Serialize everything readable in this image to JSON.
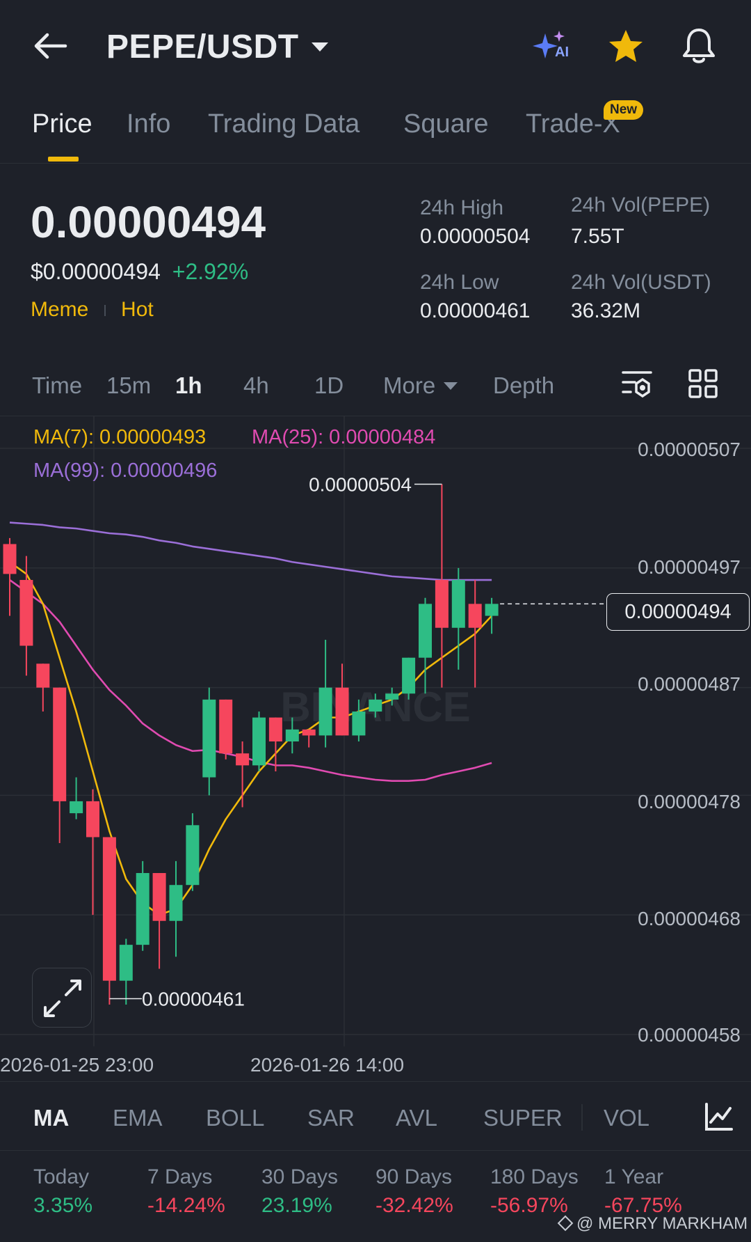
{
  "header": {
    "pair": "PEPE/USDT",
    "icons": [
      "back-arrow-icon",
      "ai-sparkle-icon",
      "star-icon",
      "bell-icon"
    ],
    "ai_label": "AI"
  },
  "tabs": [
    {
      "label": "Price",
      "active": true
    },
    {
      "label": "Info"
    },
    {
      "label": "Trading Data"
    },
    {
      "label": "Square"
    },
    {
      "label": "Trade-X",
      "badge": "New"
    }
  ],
  "price": {
    "last": "0.00000494",
    "usd": "$0.00000494",
    "change": "+2.92%",
    "tags": [
      "Meme",
      "Hot"
    ]
  },
  "stats": {
    "high_label": "24h High",
    "high_value": "0.00000504",
    "low_label": "24h Low",
    "low_value": "0.00000461",
    "vol_base_label": "24h Vol(PEPE)",
    "vol_base_value": "7.55T",
    "vol_quote_label": "24h Vol(USDT)",
    "vol_quote_value": "36.32M"
  },
  "intervals": {
    "time": "Time",
    "m15": "15m",
    "h1": "1h",
    "h4": "4h",
    "d1": "1D",
    "more": "More",
    "depth": "Depth",
    "active": "1h"
  },
  "ma": {
    "ma7": "MA(7): 0.00000493",
    "ma25": "MA(25): 0.00000484",
    "ma99": "MA(99): 0.00000496"
  },
  "colors": {
    "up": "#2ebd85",
    "down": "#f6465d",
    "accent": "#f0b90b",
    "ma7": "#f0b90b",
    "ma25": "#e04bb1",
    "ma99": "#9b6fd8",
    "bg": "#1e2129"
  },
  "chart_data": {
    "type": "candlestick",
    "interval": "1h",
    "yticks": [
      "0.00000507",
      "0.00000497",
      "0.00000487",
      "0.00000478",
      "0.00000468",
      "0.00000458"
    ],
    "ylim": [
      4.58e-06,
      5.07e-06
    ],
    "xticks": [
      "2026-01-25 23:00",
      "2026-01-26 14:00"
    ],
    "current_price_label": "0.00000494",
    "high_marker": "0.00000504",
    "low_marker": "0.00000461",
    "candles": [
      {
        "o": 4.99e-06,
        "h": 4.995e-06,
        "c": 4.965e-06,
        "l": 4.93e-06
      },
      {
        "o": 4.96e-06,
        "h": 4.98e-06,
        "c": 4.905e-06,
        "l": 4.88e-06
      },
      {
        "o": 4.89e-06,
        "h": 4.89e-06,
        "c": 4.87e-06,
        "l": 4.85e-06
      },
      {
        "o": 4.87e-06,
        "h": 4.87e-06,
        "c": 4.775e-06,
        "l": 4.74e-06
      },
      {
        "o": 4.765e-06,
        "h": 4.795e-06,
        "c": 4.775e-06,
        "l": 4.76e-06
      },
      {
        "o": 4.775e-06,
        "h": 4.785e-06,
        "c": 4.745e-06,
        "l": 4.68e-06
      },
      {
        "o": 4.745e-06,
        "h": 4.745e-06,
        "c": 4.625e-06,
        "l": 4.605e-06
      },
      {
        "o": 4.625e-06,
        "h": 4.66e-06,
        "c": 4.655e-06,
        "l": 4.605e-06
      },
      {
        "o": 4.655e-06,
        "h": 4.725e-06,
        "c": 4.715e-06,
        "l": 4.65e-06
      },
      {
        "o": 4.715e-06,
        "h": 4.715e-06,
        "c": 4.675e-06,
        "l": 4.635e-06
      },
      {
        "o": 4.675e-06,
        "h": 4.725e-06,
        "c": 4.705e-06,
        "l": 4.645e-06
      },
      {
        "o": 4.705e-06,
        "h": 4.765e-06,
        "c": 4.755e-06,
        "l": 4.7e-06
      },
      {
        "o": 4.795e-06,
        "h": 4.87e-06,
        "c": 4.86e-06,
        "l": 4.78e-06
      },
      {
        "o": 4.86e-06,
        "h": 4.86e-06,
        "c": 4.815e-06,
        "l": 4.81e-06
      },
      {
        "o": 4.815e-06,
        "h": 4.825e-06,
        "c": 4.805e-06,
        "l": 4.77e-06
      },
      {
        "o": 4.805e-06,
        "h": 4.85e-06,
        "c": 4.845e-06,
        "l": 4.8e-06
      },
      {
        "o": 4.845e-06,
        "h": 4.845e-06,
        "c": 4.825e-06,
        "l": 4.8e-06
      },
      {
        "o": 4.825e-06,
        "h": 4.845e-06,
        "c": 4.835e-06,
        "l": 4.815e-06
      },
      {
        "o": 4.835e-06,
        "h": 4.835e-06,
        "c": 4.83e-06,
        "l": 4.82e-06
      },
      {
        "o": 4.83e-06,
        "h": 4.91e-06,
        "c": 4.87e-06,
        "l": 4.82e-06
      },
      {
        "o": 4.87e-06,
        "h": 4.89e-06,
        "c": 4.83e-06,
        "l": 4.83e-06
      },
      {
        "o": 4.83e-06,
        "h": 4.86e-06,
        "c": 4.85e-06,
        "l": 4.825e-06
      },
      {
        "o": 4.85e-06,
        "h": 4.865e-06,
        "c": 4.86e-06,
        "l": 4.845e-06
      },
      {
        "o": 4.86e-06,
        "h": 4.87e-06,
        "c": 4.865e-06,
        "l": 4.855e-06
      },
      {
        "o": 4.865e-06,
        "h": 4.895e-06,
        "c": 4.895e-06,
        "l": 4.86e-06
      },
      {
        "o": 4.895e-06,
        "h": 4.945e-06,
        "c": 4.94e-06,
        "l": 4.865e-06
      },
      {
        "o": 4.96e-06,
        "h": 5.04e-06,
        "c": 4.92e-06,
        "l": 4.87e-06
      },
      {
        "o": 4.92e-06,
        "h": 4.97e-06,
        "c": 4.96e-06,
        "l": 4.885e-06
      },
      {
        "o": 4.94e-06,
        "h": 4.96e-06,
        "c": 4.92e-06,
        "l": 4.87e-06
      },
      {
        "o": 4.93e-06,
        "h": 4.945e-06,
        "c": 4.94e-06,
        "l": 4.915e-06
      }
    ],
    "ma7": [
      4.975e-06,
      4.965e-06,
      4.94e-06,
      4.895e-06,
      4.85e-06,
      4.8e-06,
      4.75e-06,
      4.71e-06,
      4.69e-06,
      4.68e-06,
      4.685e-06,
      4.705e-06,
      4.735e-06,
      4.76e-06,
      4.78e-06,
      4.8e-06,
      4.815e-06,
      4.83e-06,
      4.835e-06,
      4.845e-06,
      4.845e-06,
      4.85e-06,
      4.855e-06,
      4.86e-06,
      4.87e-06,
      4.885e-06,
      4.895e-06,
      4.905e-06,
      4.915e-06,
      4.93e-06
    ],
    "ma25": [
      4.96e-06,
      4.95e-06,
      4.94e-06,
      4.925e-06,
      4.905e-06,
      4.885e-06,
      4.868e-06,
      4.855e-06,
      4.84e-06,
      4.83e-06,
      4.822e-06,
      4.817e-06,
      4.818e-06,
      4.815e-06,
      4.812e-06,
      4.808e-06,
      4.805e-06,
      4.805e-06,
      4.803e-06,
      4.8e-06,
      4.797e-06,
      4.795e-06,
      4.793e-06,
      4.792e-06,
      4.792e-06,
      4.793e-06,
      4.797e-06,
      4.8e-06,
      4.803e-06,
      4.807e-06
    ],
    "ma99": [
      5.008e-06,
      5.007e-06,
      5.006e-06,
      5.004e-06,
      5.003e-06,
      5.001e-06,
      4.999e-06,
      4.998e-06,
      4.996e-06,
      4.993e-06,
      4.991e-06,
      4.988e-06,
      4.986e-06,
      4.984e-06,
      4.982e-06,
      4.98e-06,
      4.978e-06,
      4.975e-06,
      4.973e-06,
      4.971e-06,
      4.969e-06,
      4.967e-06,
      4.965e-06,
      4.963e-06,
      4.962e-06,
      4.961e-06,
      4.96e-06,
      4.96e-06,
      4.96e-06,
      4.96e-06
    ]
  },
  "indicators": [
    "MA",
    "EMA",
    "BOLL",
    "SAR",
    "AVL",
    "SUPER",
    "VOL"
  ],
  "performance": [
    {
      "label": "Today",
      "value": "3.35%",
      "dir": "up"
    },
    {
      "label": "7 Days",
      "value": "-14.24%",
      "dir": "down"
    },
    {
      "label": "30 Days",
      "value": "23.19%",
      "dir": "up"
    },
    {
      "label": "90 Days",
      "value": "-32.42%",
      "dir": "down"
    },
    {
      "label": "180 Days",
      "value": "-56.97%",
      "dir": "down"
    },
    {
      "label": "1 Year",
      "value": "-67.75%",
      "dir": "down"
    }
  ],
  "watermark": "@ MERRY MARKHAM",
  "chart_watermark": "BINANCE"
}
